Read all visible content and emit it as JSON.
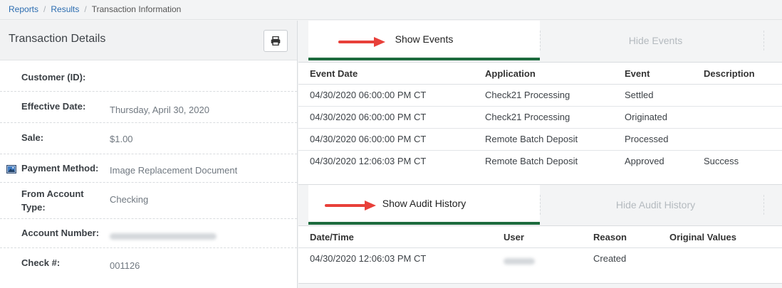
{
  "breadcrumb": {
    "items": [
      "Reports",
      "Results"
    ],
    "current": "Transaction Information"
  },
  "transaction": {
    "title": "Transaction Details",
    "fields": {
      "customer_label": "Customer (ID):",
      "effective_date_label": "Effective Date:",
      "effective_date_value": "Thursday, April 30, 2020",
      "sale_label": "Sale:",
      "sale_value": "$1.00",
      "payment_method_label": "Payment Method:",
      "payment_method_value": "Image Replacement Document",
      "from_account_type_label_1": "From Account",
      "from_account_type_label_2": "Type:",
      "from_account_type_value": "Checking",
      "account_number_label": "Account Number:",
      "check_label": "Check #:",
      "check_value": "001126"
    }
  },
  "events": {
    "show_tab": "Show Events",
    "hide_tab": "Hide Events",
    "columns": [
      "Event Date",
      "Application",
      "Event",
      "Description"
    ],
    "rows": [
      [
        "04/30/2020 06:00:00 PM CT",
        "Check21 Processing",
        "Settled",
        ""
      ],
      [
        "04/30/2020 06:00:00 PM CT",
        "Check21 Processing",
        "Originated",
        ""
      ],
      [
        "04/30/2020 06:00:00 PM CT",
        "Remote Batch Deposit",
        "Processed",
        ""
      ],
      [
        "04/30/2020 12:06:03 PM CT",
        "Remote Batch Deposit",
        "Approved",
        "Success"
      ]
    ]
  },
  "audit": {
    "show_tab": "Show Audit History",
    "hide_tab": "Hide Audit History",
    "columns": [
      "Date/Time",
      "User",
      "Reason",
      "Original Values"
    ],
    "rows": [
      [
        "04/30/2020 12:06:03 PM CT",
        "",
        "Created",
        ""
      ]
    ]
  },
  "colors": {
    "accent": "#1d6b3e",
    "arrow": "#e8403a",
    "link": "#2b6cb0"
  },
  "icons": {
    "print": "printer-icon",
    "payment": "image-icon",
    "arrow": "arrow-right-icon"
  }
}
